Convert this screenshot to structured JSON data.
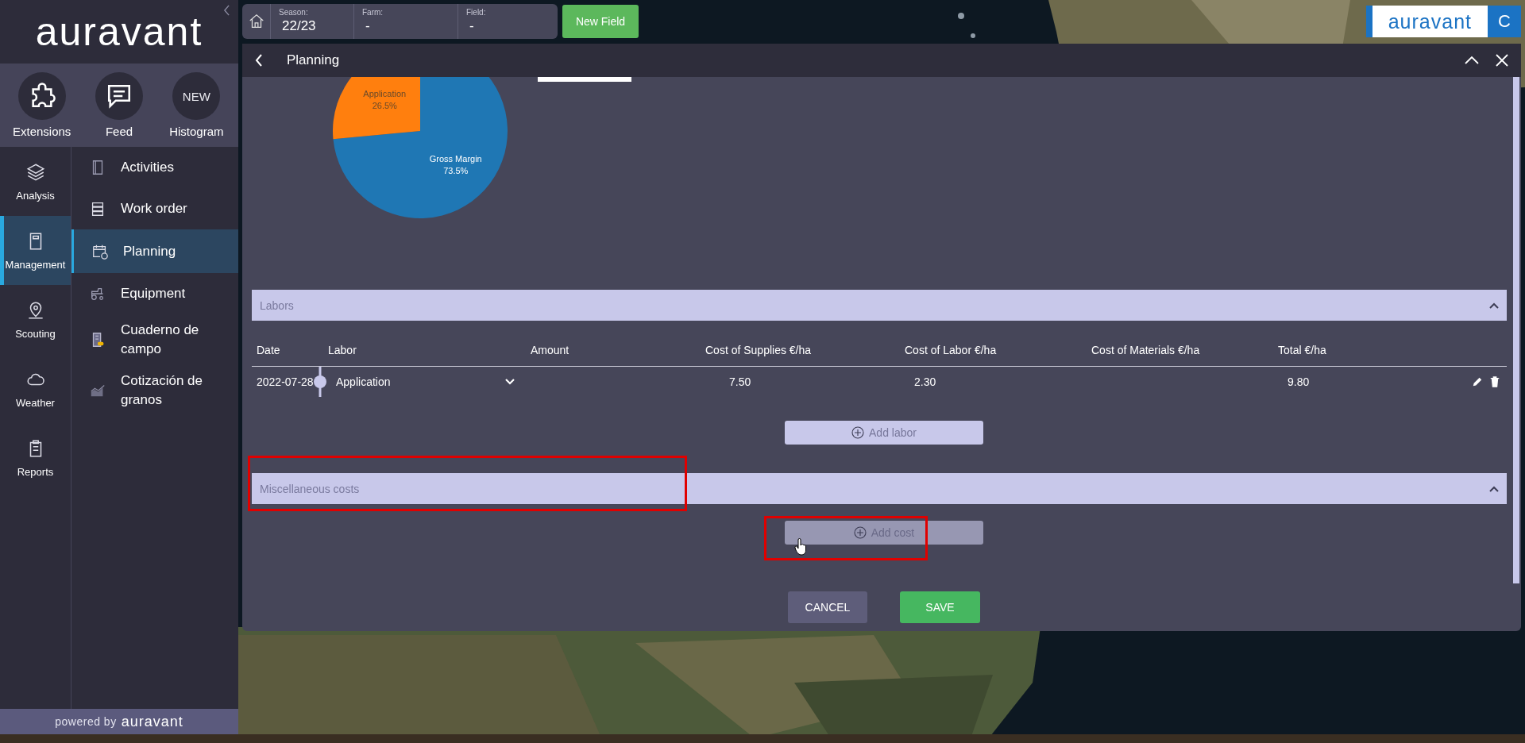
{
  "sidebar": {
    "logo": "auravant",
    "quick_actions": [
      {
        "kind": "icon",
        "label": "Extensions"
      },
      {
        "kind": "icon",
        "label": "Feed"
      },
      {
        "kind": "badge",
        "badge": "NEW",
        "label": "Histogram"
      }
    ],
    "rail": [
      {
        "label": "Analysis",
        "selected": false
      },
      {
        "label": "Management",
        "selected": true
      },
      {
        "label": "Scouting",
        "selected": false
      },
      {
        "label": "Weather",
        "selected": false
      },
      {
        "label": "Reports",
        "selected": false
      }
    ],
    "menu": [
      {
        "label": "Activities",
        "selected": false
      },
      {
        "label": "Work order",
        "selected": false
      },
      {
        "label": "Planning",
        "selected": true
      },
      {
        "label": "Equipment",
        "selected": false
      },
      {
        "label": "Cuaderno de campo",
        "selected": false
      },
      {
        "label": "Cotización de granos",
        "selected": false
      }
    ],
    "footer": {
      "prefix": "powered by",
      "brand": "auravant"
    }
  },
  "topbar": {
    "fields": [
      {
        "label": "Season:",
        "value": "22/23"
      },
      {
        "label": "Farm:",
        "value": "-"
      },
      {
        "label": "Field:",
        "value": "-"
      }
    ],
    "new_field_button": "New Field"
  },
  "brand_badge": {
    "logo": "auravant",
    "initial": "C"
  },
  "dialog": {
    "title": "Planning",
    "chart_data": {
      "type": "pie",
      "categories": [
        "Gross Margin",
        "Application"
      ],
      "values": [
        73.5,
        26.5
      ],
      "colors": [
        "#1f77b4",
        "#ff7f0e"
      ],
      "value_labels": [
        "73.5%",
        "26.5%"
      ]
    },
    "sections": [
      {
        "title": "Labors",
        "expanded": true,
        "highlighted": false,
        "table": {
          "columns": [
            "Date",
            "Labor",
            "Amount",
            "Cost of Supplies €/ha",
            "Cost of Labor €/ha",
            "Cost of Materials €/ha",
            "Total €/ha"
          ],
          "rows": [
            {
              "date": "2022-07-28",
              "labor": "Application",
              "cost_of_supplies": "7.50",
              "cost_of_labor": "2.30",
              "total": "9.80"
            }
          ]
        },
        "add_button": {
          "label": "Add labor",
          "hovered": false,
          "highlighted": false
        }
      },
      {
        "title": "Miscellaneous costs",
        "expanded": true,
        "highlighted": true,
        "add_button": {
          "label": "Add cost",
          "hovered": true,
          "highlighted": true
        }
      }
    ],
    "buttons": [
      {
        "kind": "cancel",
        "label": "CANCEL"
      },
      {
        "kind": "save",
        "label": "SAVE"
      }
    ]
  }
}
